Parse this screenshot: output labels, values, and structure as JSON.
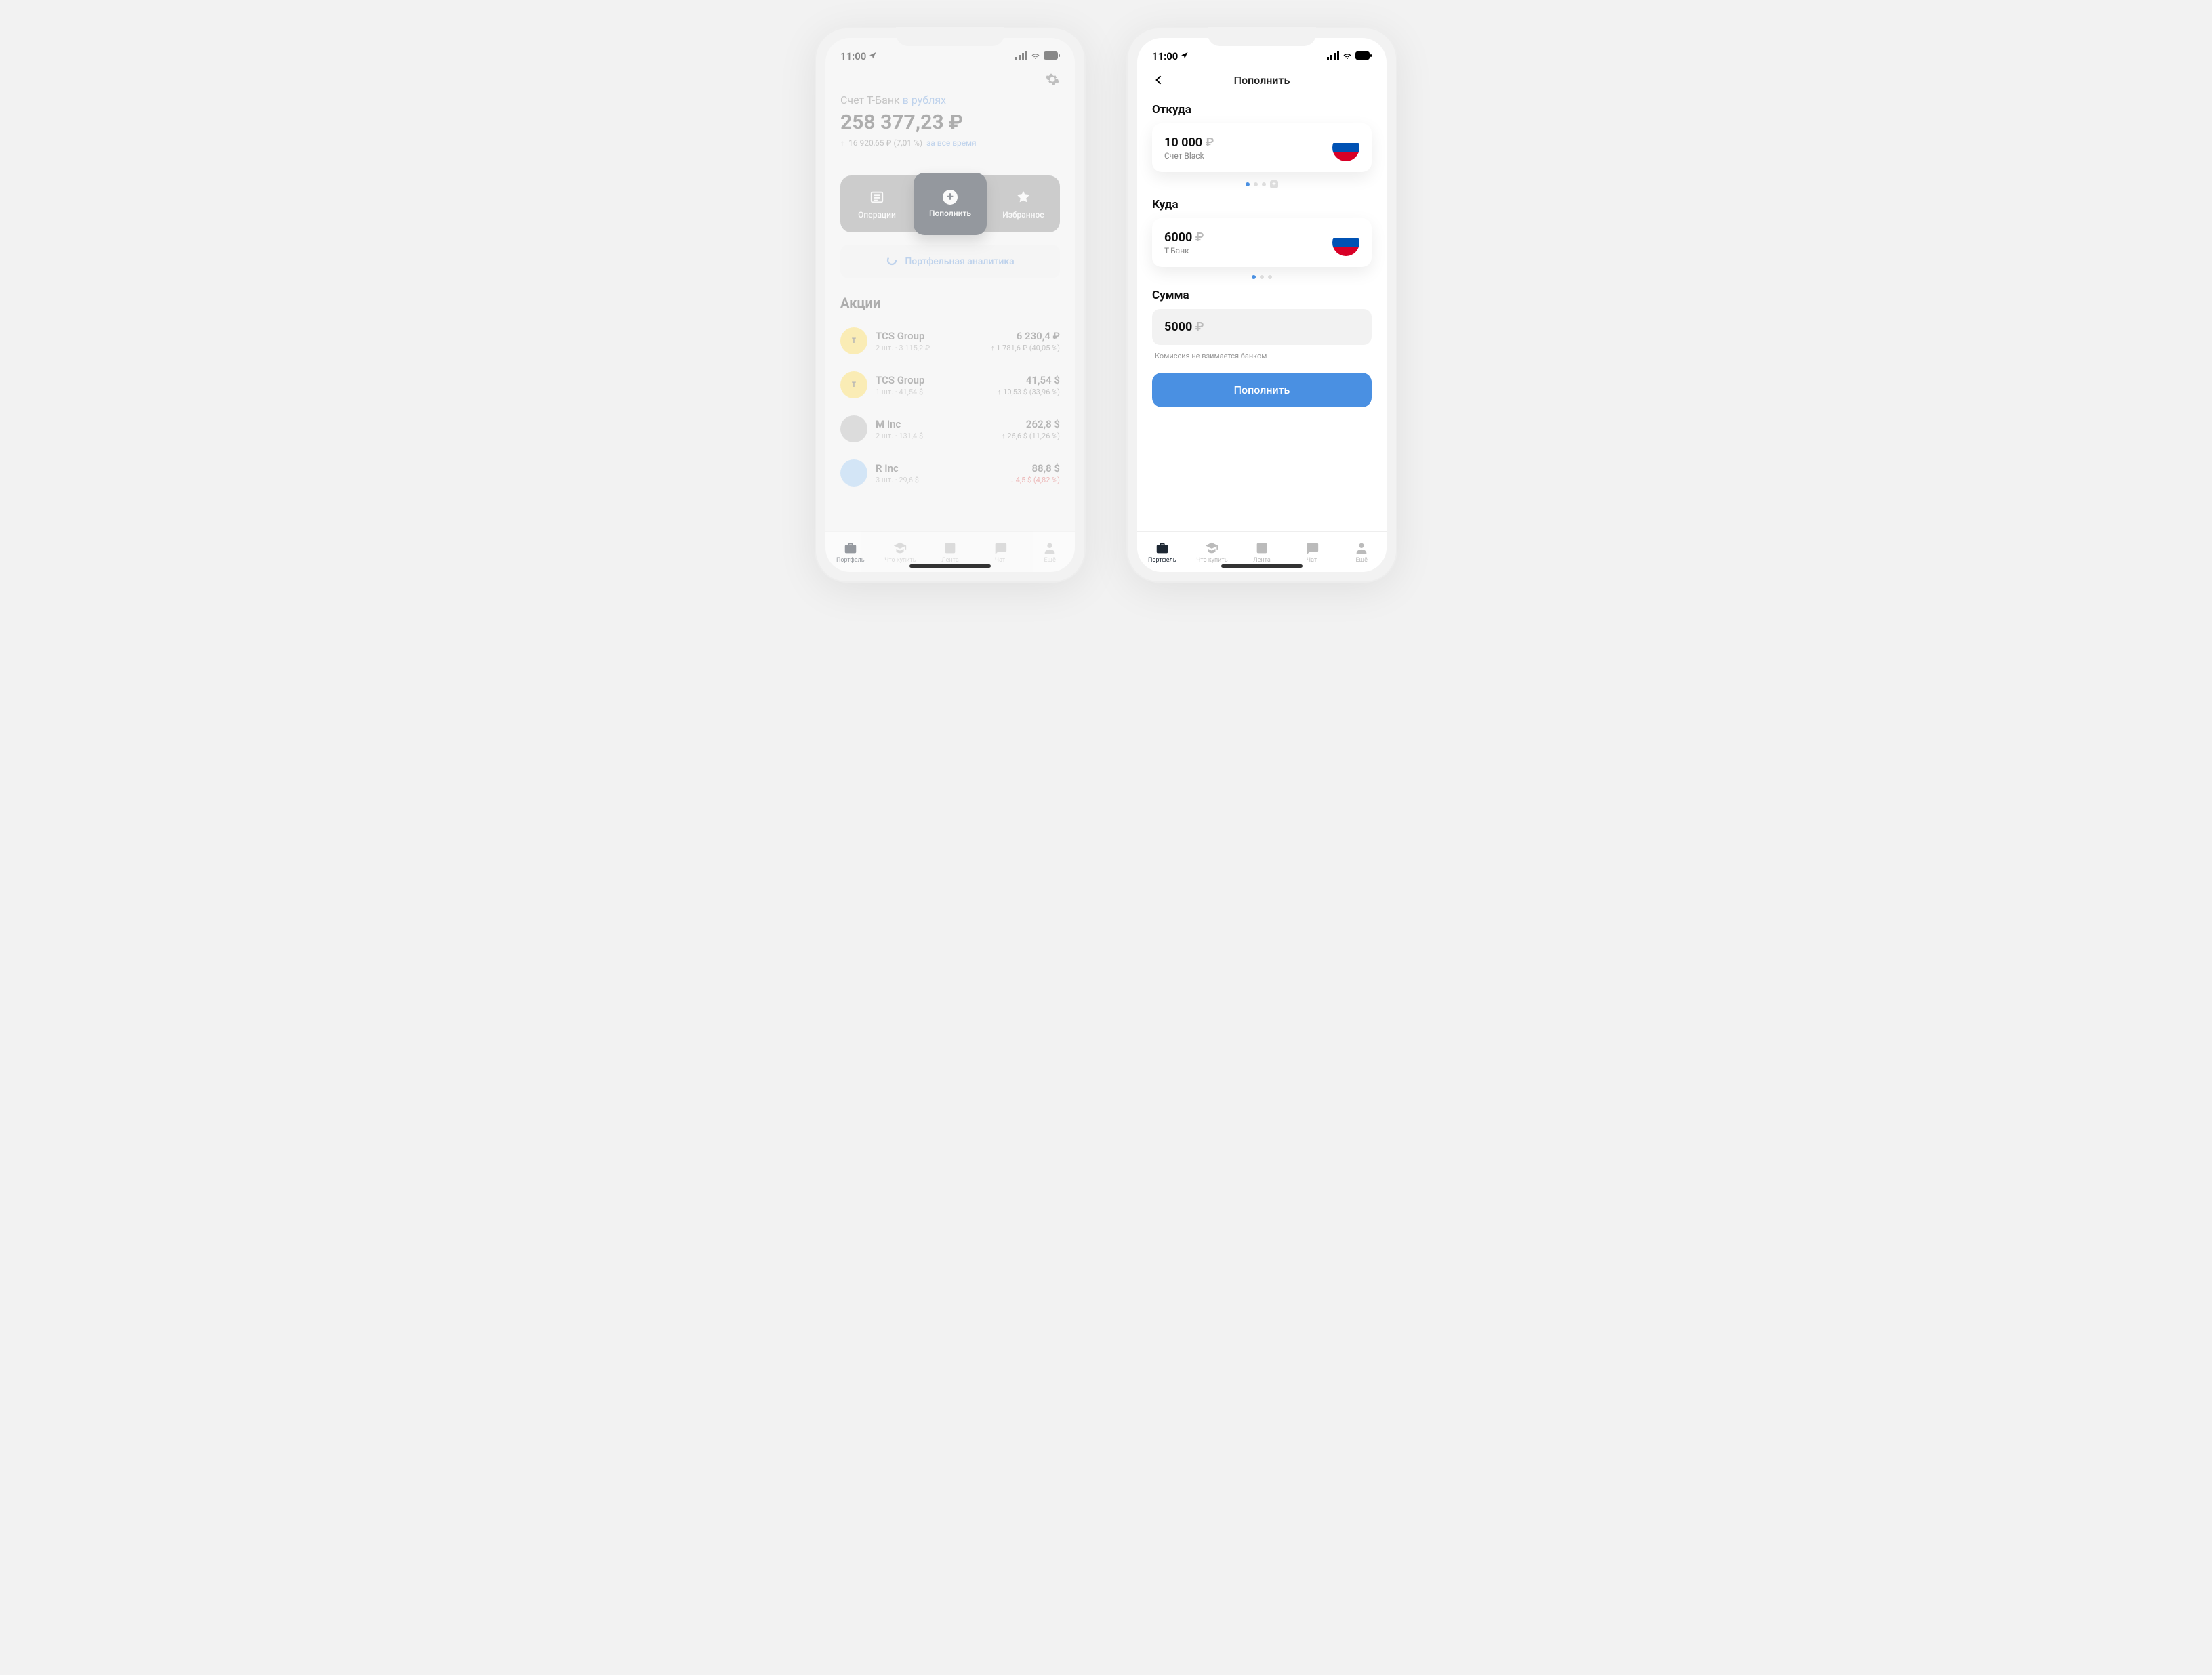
{
  "status": {
    "time": "11:00"
  },
  "screen1": {
    "account_label": "Счет Т-Банк",
    "account_currency_link": "в рублях",
    "balance": "258 377,23 ₽",
    "delta_value": "16 920,65 ₽ (7,01 %)",
    "delta_period": "за все время",
    "actions": {
      "operations": "Операции",
      "topup": "Пополнить",
      "favorites": "Избранное"
    },
    "analytics": "Портфельная аналитика",
    "section_stocks": "Акции",
    "stocks": [
      {
        "name": "TCS Group",
        "sub": "2 шт. · 3 115,2 ₽",
        "price": "6 230,4 ₽",
        "change": "↑ 1 781,6 ₽ (40,05 %)",
        "dir": "up",
        "avatar_bg": "#ffe066",
        "avatar_letter": "T"
      },
      {
        "name": "TCS Group",
        "sub": "1 шт. · 41,54 $",
        "price": "41,54 $",
        "change": "↑ 10,53 $ (33,96 %)",
        "dir": "up",
        "avatar_bg": "#ffe066",
        "avatar_letter": "T"
      },
      {
        "name": "M Inc",
        "sub": "2 шт. · 131,4 $",
        "price": "262,8 $",
        "change": "↑ 26,6 $ (11,26 %)",
        "dir": "up",
        "avatar_bg": "#bdbdbd",
        "avatar_letter": ""
      },
      {
        "name": "R Inc",
        "sub": "3 шт. · 29,6 $",
        "price": "88,8 $",
        "change": "↓ 4,5 $ (4,82 %)",
        "dir": "down",
        "avatar_bg": "#a9d0f5",
        "avatar_letter": ""
      }
    ]
  },
  "screen2": {
    "title": "Пополнить",
    "from_label": "Откуда",
    "from_amount": "10 000",
    "from_sub": "Счет Black",
    "to_label": "Куда",
    "to_amount": "6000",
    "to_sub": "Т-Банк",
    "sum_label": "Сумма",
    "sum_value": "5000",
    "fee_note": "Комиссия не взимается банком",
    "submit": "Пополнить"
  },
  "tabs": {
    "portfolio": "Портфель",
    "buy": "Что купить",
    "feed": "Лента",
    "chat": "Чат",
    "more": "Ещё"
  },
  "ruble": "₽"
}
